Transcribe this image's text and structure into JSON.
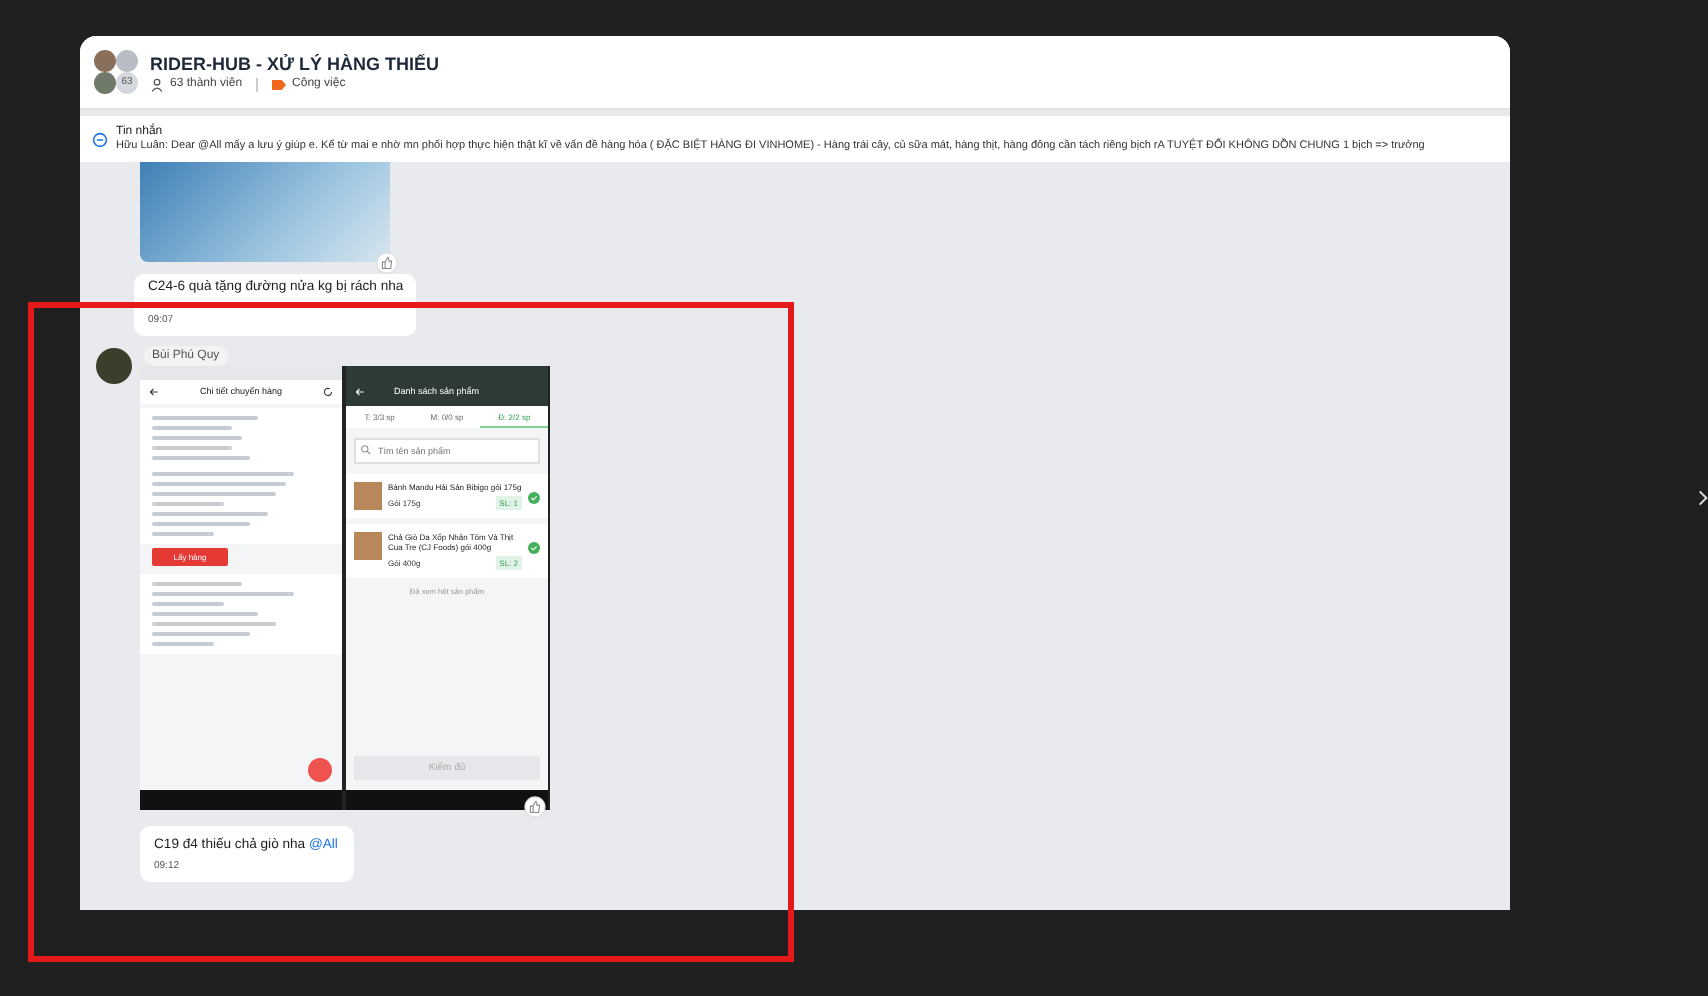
{
  "chat": {
    "title": "RIDER-HUB - XỬ LÝ HÀNG THIẾU",
    "avatar_count": "63",
    "members": "63 thành viên",
    "tag": "Công việc"
  },
  "pinned": {
    "label": "Tin nhắn",
    "text": "Hữu Luân: Dear @All mấy a lưu ý giúp e. Kể từ mai e nhờ mn phối hợp thực hiện thật kĩ về vấn đề hàng hóa ( ĐẶC BIỆT HÀNG ĐI VINHOME) - Hàng trái cây, củ sữa mát, hàng thịt, hàng đông cần tách riêng bịch rA TUYỆT ĐỐI KHÔNG DỒN CHUNG 1 bịch => trưởng"
  },
  "first_message": {
    "text": "C24-6 quà tặng đường nửa kg bị rách nha",
    "time": "09:07"
  },
  "sender": "Bùi Phú Quy",
  "shared_screenshot": {
    "left": {
      "title": "Chi tiết chuyến hàng",
      "action_button": "Lấy hàng"
    },
    "right": {
      "title": "Danh sách sản phẩm",
      "tabs": [
        {
          "label": "T: 3/3 sp",
          "selected": false
        },
        {
          "label": "M: 0/0 sp",
          "selected": false
        },
        {
          "label": "Đ: 2/2 sp",
          "selected": true
        }
      ],
      "search_placeholder": "Tìm tên sản phẩm",
      "products": [
        {
          "name": "Bánh Mandu Hải Sản Bibigo gói 175g",
          "pack": "Gói 175g",
          "qty": "SL: 1"
        },
        {
          "name": "Chả Giò Da Xốp Nhân Tôm Và Thịt Cua Tre (CJ Foods) gói 400g",
          "pack": "Gói 400g",
          "qty": "SL: 2"
        }
      ],
      "end_note": "Đã xem hết sản phẩm",
      "button": "Kiểm đủ"
    }
  },
  "second_message": {
    "text": "C19 đ4 thiếu chả giò nha",
    "mention": "@All",
    "time": "09:12"
  }
}
